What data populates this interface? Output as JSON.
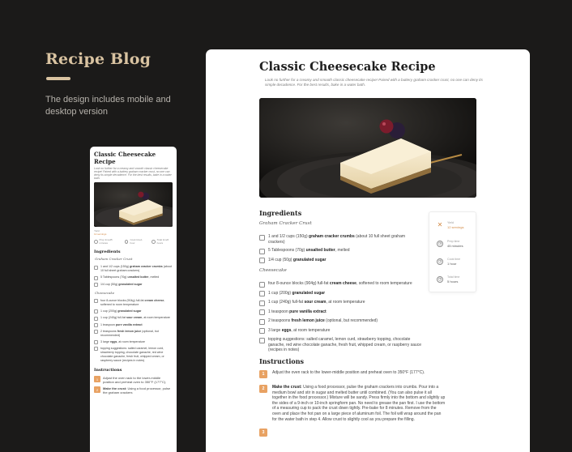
{
  "brand": {
    "title": "Recipe Blog",
    "description": "The design includes mobile and desktop version"
  },
  "recipe": {
    "title": "Classic Cheesecake Recipe",
    "intro": "Look no further for a creamy and smooth classic cheesecake recipe! Paired with a buttery graham cracker crust, no one can deny its simple decadence. For the best results, bake in a water bath.",
    "meta": [
      {
        "label": "Yield",
        "value": "12 servings",
        "icon": "utensils-icon"
      },
      {
        "label": "Prep time",
        "value": "45 minutes",
        "icon": "clock-icon"
      },
      {
        "label": "Cook time",
        "value": "1 hour",
        "icon": "clock-icon"
      },
      {
        "label": "Total time",
        "value": "5 hours",
        "icon": "clock-icon"
      }
    ],
    "mobile_meta": [
      {
        "label": "Yield",
        "value": "12 servings"
      },
      {
        "label": "Prep time",
        "value": "45 minutes"
      },
      {
        "label": "Cook time",
        "value": "1 hour"
      },
      {
        "label": "Total time",
        "value": "5 hours"
      }
    ],
    "ingredients_heading": "Ingredients",
    "crust_heading": "Graham Cracker Crust",
    "crust": [
      {
        "pre": "1 and 1/2 cups (150g) ",
        "bold": "graham cracker crumbs",
        "post": " (about 10 full sheet graham crackers)"
      },
      {
        "pre": "5 Tablespoons (70g) ",
        "bold": "unsalted butter",
        "post": ", melted"
      },
      {
        "pre": "1/4 cup (50g) ",
        "bold": "granulated sugar",
        "post": ""
      }
    ],
    "filling_heading": "Cheesecake",
    "filling": [
      {
        "pre": "four 8-ounce blocks (904g) full-fat ",
        "bold": "cream cheese",
        "post": ", softened to room temperature"
      },
      {
        "pre": "1 cup (200g) ",
        "bold": "granulated sugar",
        "post": ""
      },
      {
        "pre": "1 cup (240g) full-fat ",
        "bold": "sour cream",
        "post": ", at room temperature"
      },
      {
        "pre": "1 teaspoon ",
        "bold": "pure vanilla extract",
        "post": ""
      },
      {
        "pre": "2 teaspoons ",
        "bold": "fresh lemon juice",
        "post": " (optional, but recommended)"
      },
      {
        "pre": "3 large ",
        "bold": "eggs",
        "post": ", at room temperature"
      },
      {
        "pre": "topping suggestions: ",
        "bold": "",
        "post": "salted caramel, lemon curd, strawberry topping, chocolate ganache, red wine chocolate ganache, fresh fruit, whipped cream, or raspberry sauce (recipes in notes)"
      }
    ],
    "instructions_heading": "Instructions",
    "steps": [
      {
        "num": "1",
        "bold": "",
        "text": "Adjust the oven rack to the lower-middle position and preheat oven to 350°F (177°C)."
      },
      {
        "num": "2",
        "bold": "Make the crust:",
        "text": " Using a food processor, pulse the graham crackers into crumbs. Pour into a medium bowl and stir in sugar and melted butter until combined. (You can also pulse it all together in the food processor.) Mixture will be sandy. Press firmly into the bottom and slightly up the sides of a 9-inch or 10-inch springform pan. No need to grease the pan first. I use the bottom of a measuring cup to pack the crust down tightly. Pre-bake for 8 minutes. Remove from the oven and place the hot pan on a large piece of aluminum foil. The foil will wrap around the pan for the water bath in step 4. Allow crust to slightly cool as you prepare the filling."
      },
      {
        "num": "3",
        "bold": "",
        "text": ""
      }
    ],
    "mobile_steps": [
      {
        "num": "1",
        "bold": "",
        "text": "Adjust the oven rack to the lower-middle position and preheat oven to 350°F (177°C)."
      },
      {
        "num": "2",
        "bold": "Make the crust:",
        "text": " Using a food processor, pulse the graham crackers"
      }
    ]
  }
}
